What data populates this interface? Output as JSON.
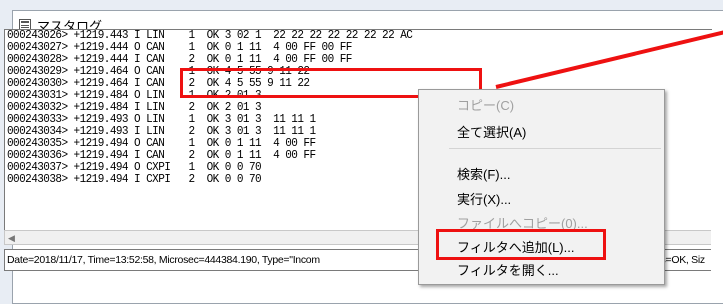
{
  "window": {
    "title": "マスタログ"
  },
  "log_lines": [
    "000243026> +1219.443 I LIN    1  OK 3 02 1  22 22 22 22 22 22 22 AC",
    "000243027> +1219.444 O CAN    1  OK 0 1 11  4 00 FF 00 FF",
    "000243028> +1219.444 I CAN    2  OK 0 1 11  4 00 FF 00 FF",
    "000243029> +1219.464 O CAN    1  OK 4 5 55 9 11 22",
    "000243030> +1219.464 I CAN    2  OK 4 5 55 9 11 22",
    "000243031> +1219.484 O LIN    1  OK 2 01 3",
    "000243032> +1219.484 I LIN    2  OK 2 01 3",
    "000243033> +1219.493 O LIN    1  OK 3 01 3  11 11 1",
    "000243034> +1219.493 I LIN    2  OK 3 01 3  11 11 1",
    "000243035> +1219.494 O CAN    1  OK 0 1 11  4 00 FF",
    "000243036> +1219.494 I CAN    2  OK 0 1 11  4 00 FF",
    "000243037> +1219.494 O CXPI   1  OK 0 0 70",
    "000243038> +1219.494 I CXPI   2  OK 0 0 70"
  ],
  "detail": {
    "text": "Date=2018/11/17, Time=13:52:58, Microsec=444384.190, Type=\"Incom",
    "text_right": "us=OK, Siz"
  },
  "context_menu": {
    "items": [
      {
        "label": "コピー(C)",
        "enabled": false
      },
      {
        "label": "全て選択(A)",
        "enabled": true
      },
      {
        "label": "検索(F)...",
        "enabled": true
      },
      {
        "label": "実行(X)...",
        "enabled": true
      },
      {
        "label": "ファイルへコピー(0)...",
        "enabled": false
      },
      {
        "label": "フィルタへ追加(L)...",
        "enabled": true
      },
      {
        "label": "フィルタを開く...",
        "enabled": true
      }
    ]
  },
  "colors": {
    "highlight": "#ee1111",
    "menu_bg": "#f2f2f2",
    "disabled_text": "#a0a0a0"
  },
  "icons": {
    "title": "log-window-icon",
    "scroll_left": "scroll-left-arrow-icon"
  }
}
